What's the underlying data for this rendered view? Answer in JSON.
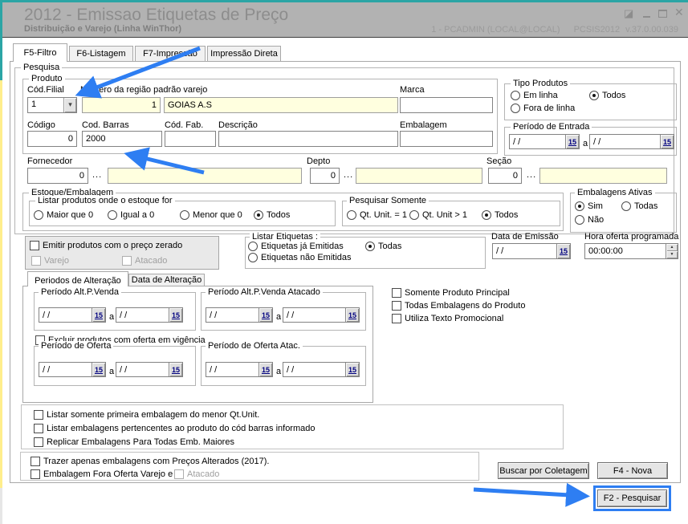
{
  "window": {
    "title": "2012 - Emissao Etiquetas de Preço",
    "subtitle": "Distribuição e Varejo (Linha WinThor)",
    "user_session": "1 - PCADMIN (LOCAL@LOCAL)",
    "app_name": "PCSIS2012",
    "app_version": "v.37.0.00.039"
  },
  "icons": {
    "resize": "◪",
    "close": "✕",
    "dropdown": "▾",
    "calendar": "15",
    "lookup": "...",
    "spin_up": "▲",
    "spin_down": "▼"
  },
  "colors": {
    "accent_blue": "#2e7ef2",
    "teal": "#2ba5a5",
    "field_yellow": "#ffffdf",
    "titlebar_gray": "#b2b2b2"
  },
  "ui": {
    "range_separator": "a"
  },
  "main_tabs": [
    {
      "label": "F5-Filtro",
      "active": true
    },
    {
      "label": "F6-Listagem",
      "active": false
    },
    {
      "label": "F7-Impressão",
      "active": false
    },
    {
      "label": "Impressão Direta",
      "active": false
    }
  ],
  "filter": {
    "pesquisa_legend": "Pesquisa",
    "produto": {
      "legend": "Produto",
      "cod_filial_label": "Cód.Filial",
      "cod_filial_value": "1",
      "regiao_label": "Numero da região padrão varejo",
      "regiao_num": "1",
      "regiao_nome": "GOIAS A.S",
      "marca_label": "Marca",
      "marca_value": "",
      "codigo_label": "Código",
      "codigo_value": "0",
      "cod_barras_label": "Cod. Barras",
      "cod_barras_value": "2000",
      "cod_fab_label": "Cód. Fab.",
      "cod_fab_value": "",
      "descricao_label": "Descrição",
      "descricao_value": "",
      "embalagem_label": "Embalagem",
      "embalagem_value": ""
    },
    "tipo_produtos": {
      "legend": "Tipo Produtos",
      "options": [
        {
          "label": "Em linha",
          "selected": false
        },
        {
          "label": "Fora de linha",
          "selected": false
        },
        {
          "label": "Todos",
          "selected": true
        }
      ]
    },
    "periodo_entrada": {
      "legend": "Período de Entrada",
      "from_value": "/ /",
      "to_value": "/ /"
    },
    "fornecedor": {
      "label": "Fornecedor",
      "code": "0",
      "name": ""
    },
    "depto": {
      "label": "Depto",
      "code": "0",
      "name": ""
    },
    "secao": {
      "label": "Seção",
      "code": "0",
      "name": ""
    },
    "estoque": {
      "legend": "Estoque/Embalagem",
      "listar_legend": "Listar produtos onde o estoque for",
      "listar_options": [
        {
          "label": "Maior que 0",
          "selected": false
        },
        {
          "label": "Igual a 0",
          "selected": false
        },
        {
          "label": "Menor que 0",
          "selected": false
        },
        {
          "label": "Todos",
          "selected": true
        }
      ],
      "pesquisar_legend": "Pesquisar Somente",
      "pesquisar_options": [
        {
          "label": "Qt. Unit. = 1",
          "selected": false
        },
        {
          "label": "Qt. Unit  > 1",
          "selected": false
        },
        {
          "label": "Todos",
          "selected": true
        }
      ]
    },
    "embalagens_ativas": {
      "legend": "Embalagens Ativas",
      "options": [
        {
          "label": "Sim",
          "selected": true
        },
        {
          "label": "Todas",
          "selected": false
        },
        {
          "label": "Não",
          "selected": false
        }
      ]
    },
    "preco_zerado": {
      "label": "Emitir produtos com o preço zerado",
      "checked": false,
      "varejo_label": "Varejo",
      "atacado_label": "Atacado"
    },
    "listar_etiquetas": {
      "legend": "Listar Etiquetas :",
      "options": [
        {
          "label": "Etiquetas já Emitidas",
          "selected": false
        },
        {
          "label": "Etiquetas não Emitidas",
          "selected": false
        },
        {
          "label": "Todas",
          "selected": true
        }
      ]
    },
    "data_emissao": {
      "label": "Data de Emissão",
      "value": "/ /"
    },
    "hora_oferta": {
      "label": "Hora oferta programada",
      "value": "00:00:00"
    },
    "alteracao": {
      "tabs": [
        {
          "label": "Periodos de Alteração",
          "active": true
        },
        {
          "label": "Data de Alteração",
          "active": false
        }
      ],
      "periodo_alt_venda": {
        "legend": "Período Alt.P.Venda",
        "from_value": "/ /",
        "to_value": "/ /"
      },
      "periodo_alt_venda_atacado": {
        "legend": "Período Alt.P.Venda Atacado",
        "from_value": "/ /",
        "to_value": "/ /"
      },
      "excluir_oferta": {
        "label": "Excluir produtos com oferta em vigência",
        "checked": false
      },
      "periodo_oferta": {
        "legend": "Período de Oferta",
        "from_value": "/ /",
        "to_value": "/ /"
      },
      "periodo_oferta_atac": {
        "legend": "Período de Oferta Atac.",
        "from_value": "/ /",
        "to_value": "/ /"
      }
    },
    "opcoes_produto": [
      {
        "label": "Somente Produto Principal",
        "checked": false
      },
      {
        "label": "Todas Embalagens do Produto",
        "checked": false
      },
      {
        "label": "Utiliza Texto Promocional",
        "checked": false
      }
    ],
    "opcoes_listagem": [
      {
        "label": "Listar somente primeira embalagem do menor Qt.Unit.",
        "checked": false
      },
      {
        "label": "Listar embalagens pertencentes ao produto do cód barras informado",
        "checked": false
      },
      {
        "label": "Replicar Embalagens Para Todas Emb. Maiores",
        "checked": false
      }
    ],
    "opcoes_precos": {
      "trazer_label": "Trazer apenas embalagens com Preços Alterados (2017).",
      "trazer_checked": false,
      "fora_oferta_label": "Embalagem Fora Oferta Varejo e",
      "fora_oferta_checked": false,
      "atacado_label": "Atacado"
    }
  },
  "buttons": {
    "buscar_coletagem": "Buscar por Coletagem",
    "f4_nova": "F4 - Nova",
    "f2_pesquisar": "F2 - Pesquisar"
  }
}
